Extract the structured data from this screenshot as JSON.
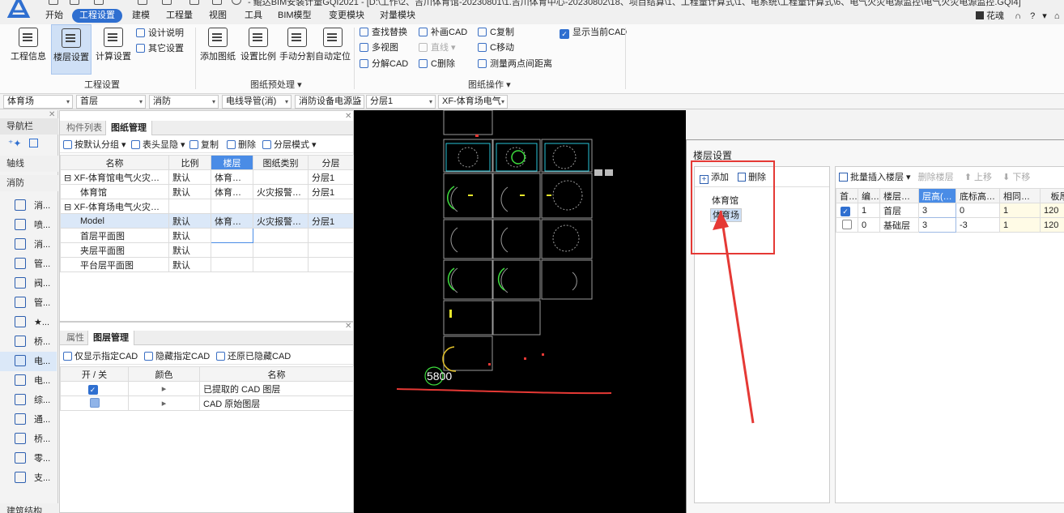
{
  "window": {
    "title": "- 鲲达BIM安装计量GQI2021 - [D:\\工作\\2、吉川体育馆-20230801\\1.吉川体育中心-20230802\\18、项目结算\\1、工程量计算式\\1、电系统\\工程量计算式\\6、电气火灾电源监控\\电气火灾电源监控.GQI4]"
  },
  "menu": {
    "tabs": [
      "开始",
      "工程设置",
      "建模",
      "工程量",
      "视图",
      "工具",
      "BIM模型",
      "变更模块",
      "对量模块"
    ],
    "active_tab": "工程设置",
    "user": "花魂",
    "help": "?"
  },
  "ribbon": {
    "project_info": "工程信息",
    "floor_settings": "楼层设置",
    "calc_settings": "计算设置",
    "design_notes": "设计说明",
    "other_settings": "其它设置",
    "group_project": "工程设置",
    "add_drawing": "添加图纸",
    "set_scale": "设置比例",
    "manual_split": "手动分割",
    "auto_locate": "自动定位",
    "group_preprocess": "图纸预处理",
    "find_replace": "查找替换",
    "redraw_cad": "补画CAD",
    "copy_c": "C复制",
    "show_current_cad": "显示当前CAD",
    "multi_view": "多视图",
    "line": "直线",
    "move_c": "C移动",
    "decompose_cad": "分解CAD",
    "delete_c": "C删除",
    "measure_distance": "测量两点间距离",
    "group_drawing_ops": "图纸操作"
  },
  "selectors": [
    "体育场",
    "首层",
    "消防",
    "电线导管(消)",
    "消防设备电源监",
    "分层1",
    "XF-体育场电气"
  ],
  "nav": {
    "header": "导航栏",
    "sections": [
      "轴线",
      "消防"
    ],
    "items": [
      "消...",
      "喷...",
      "消...",
      "管...",
      "阀...",
      "管...",
      "★...",
      "桥...",
      "电...",
      "电...",
      "综...",
      "通...",
      "桥...",
      "零...",
      "支..."
    ],
    "footer": "建筑结构"
  },
  "drawing_panel": {
    "tabs": [
      "构件列表",
      "图纸管理"
    ],
    "active_tab": "图纸管理",
    "toolbar": [
      "按默认分组",
      "表头显隐",
      "复制",
      "删除",
      "分层模式"
    ],
    "columns": [
      "名称",
      "比例",
      "楼层",
      "图纸类别",
      "分层"
    ],
    "rows": [
      [
        "⊟ XF-体育馆电气火灾、...",
        "默认",
        "体育馆-...",
        "",
        "分层1"
      ],
      [
        "体育馆",
        "默认",
        "体育馆-...",
        "火灾报警系统",
        "分层1"
      ],
      [
        "⊟ XF-体育场电气火灾、...",
        "",
        "",
        "",
        ""
      ],
      [
        "Model",
        "默认",
        "体育场-...",
        "火灾报警系统",
        "分层1"
      ],
      [
        "首层平面图",
        "默认",
        "",
        "",
        ""
      ],
      [
        "夹层平面图",
        "默认",
        "",
        "",
        ""
      ],
      [
        "平台层平面图",
        "默认",
        "",
        "",
        ""
      ]
    ]
  },
  "layer_panel": {
    "tabs": [
      "属性",
      "图层管理"
    ],
    "active_tab": "图层管理",
    "toolbar": [
      "仅显示指定CAD",
      "隐藏指定CAD",
      "还原已隐藏CAD"
    ],
    "columns": [
      "开 / 关",
      "颜色",
      "名称"
    ],
    "rows": [
      {
        "checked": true,
        "name": "已提取的 CAD 图层"
      },
      {
        "checked": false,
        "name": "CAD 原始图层"
      }
    ]
  },
  "canvas": {
    "label": "5800"
  },
  "dialog": {
    "title": "楼层设置",
    "add": "添加",
    "delete": "删除",
    "tree": [
      "体育馆",
      "体育场"
    ],
    "selected": "体育场",
    "right_toolbar": [
      "批量插入楼层",
      "删除楼层",
      "上移",
      "下移"
    ],
    "columns": [
      "首层",
      "编码",
      "楼层名称",
      "层高(m)",
      "底标高(m)",
      "相同层数",
      "板厚"
    ],
    "rows": [
      {
        "first": true,
        "code": "1",
        "name": "首层",
        "height": "3",
        "base": "0",
        "same": "1",
        "thick": "120"
      },
      {
        "first": false,
        "code": "0",
        "name": "基础层",
        "height": "3",
        "base": "-3",
        "same": "1",
        "thick": "120"
      }
    ]
  },
  "colors": {
    "accent": "#2f6fd0",
    "annotation_red": "#e53935",
    "header_blue": "#4a8ce6"
  }
}
